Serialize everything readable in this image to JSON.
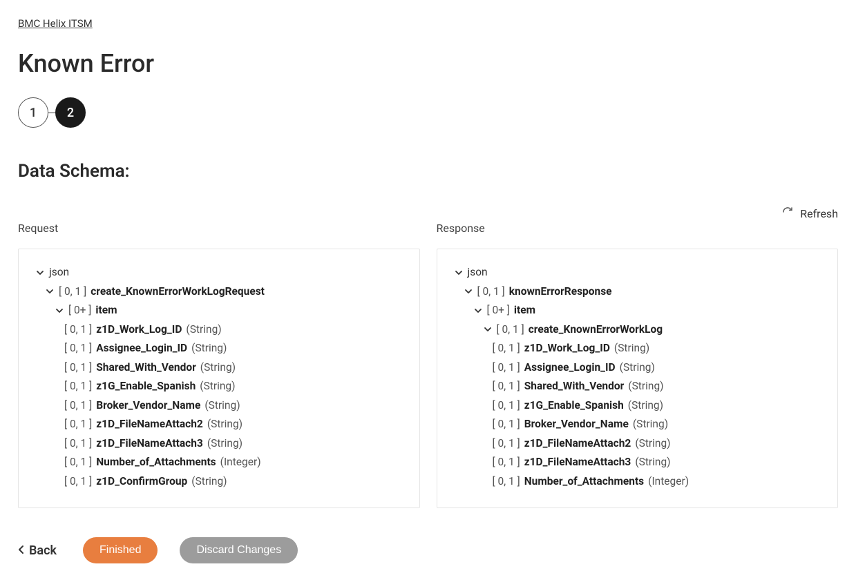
{
  "breadcrumb": "BMC Helix ITSM",
  "page_title": "Known Error",
  "stepper": {
    "step1": "1",
    "step2": "2"
  },
  "section_title": "Data Schema:",
  "refresh_label": "Refresh",
  "columns": {
    "request_label": "Request",
    "response_label": "Response"
  },
  "request_tree": {
    "root": "json",
    "level1": {
      "card": "[ 0, 1 ]",
      "name": "create_KnownErrorWorkLogRequest"
    },
    "level2": {
      "card": "[ 0+ ]",
      "name": "item"
    },
    "fields": [
      {
        "card": "[ 0, 1 ]",
        "name": "z1D_Work_Log_ID",
        "type": "(String)"
      },
      {
        "card": "[ 0, 1 ]",
        "name": "Assignee_Login_ID",
        "type": "(String)"
      },
      {
        "card": "[ 0, 1 ]",
        "name": "Shared_With_Vendor",
        "type": "(String)"
      },
      {
        "card": "[ 0, 1 ]",
        "name": "z1G_Enable_Spanish",
        "type": "(String)"
      },
      {
        "card": "[ 0, 1 ]",
        "name": "Broker_Vendor_Name",
        "type": "(String)"
      },
      {
        "card": "[ 0, 1 ]",
        "name": "z1D_FileNameAttach2",
        "type": "(String)"
      },
      {
        "card": "[ 0, 1 ]",
        "name": "z1D_FileNameAttach3",
        "type": "(String)"
      },
      {
        "card": "[ 0, 1 ]",
        "name": "Number_of_Attachments",
        "type": "(Integer)"
      },
      {
        "card": "[ 0, 1 ]",
        "name": "z1D_ConfirmGroup",
        "type": "(String)"
      }
    ]
  },
  "response_tree": {
    "root": "json",
    "level1": {
      "card": "[ 0, 1 ]",
      "name": "knownErrorResponse"
    },
    "level2": {
      "card": "[ 0+ ]",
      "name": "item"
    },
    "level3": {
      "card": "[ 0, 1 ]",
      "name": "create_KnownErrorWorkLog"
    },
    "fields": [
      {
        "card": "[ 0, 1 ]",
        "name": "z1D_Work_Log_ID",
        "type": "(String)"
      },
      {
        "card": "[ 0, 1 ]",
        "name": "Assignee_Login_ID",
        "type": "(String)"
      },
      {
        "card": "[ 0, 1 ]",
        "name": "Shared_With_Vendor",
        "type": "(String)"
      },
      {
        "card": "[ 0, 1 ]",
        "name": "z1G_Enable_Spanish",
        "type": "(String)"
      },
      {
        "card": "[ 0, 1 ]",
        "name": "Broker_Vendor_Name",
        "type": "(String)"
      },
      {
        "card": "[ 0, 1 ]",
        "name": "z1D_FileNameAttach2",
        "type": "(String)"
      },
      {
        "card": "[ 0, 1 ]",
        "name": "z1D_FileNameAttach3",
        "type": "(String)"
      },
      {
        "card": "[ 0, 1 ]",
        "name": "Number_of_Attachments",
        "type": "(Integer)"
      }
    ]
  },
  "footer": {
    "back": "Back",
    "finished": "Finished",
    "discard": "Discard Changes"
  }
}
